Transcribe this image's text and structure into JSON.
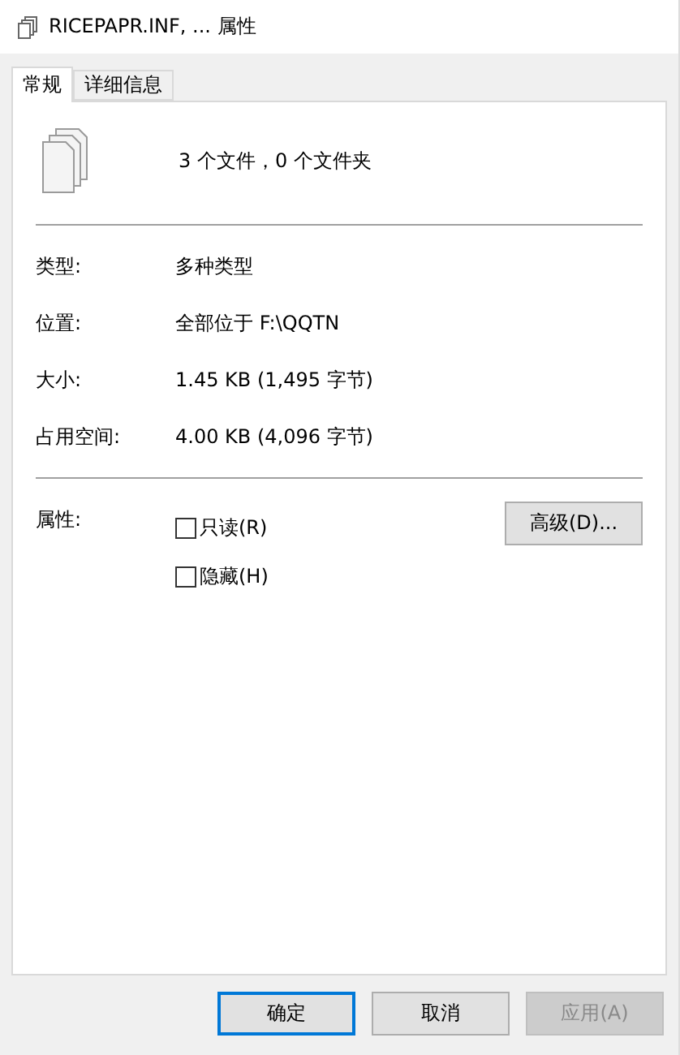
{
  "window": {
    "title": "RICEPAPR.INF, ... 属性"
  },
  "tabs": [
    {
      "label": "常规",
      "selected": true
    },
    {
      "label": "详细信息",
      "selected": false
    }
  ],
  "summary": "3 个文件，0 个文件夹",
  "details": [
    {
      "label": "类型:",
      "value": "多种类型"
    },
    {
      "label": "位置:",
      "value": "全部位于 F:\\QQTN"
    },
    {
      "label": "大小:",
      "value": "1.45 KB (1,495 字节)"
    },
    {
      "label": "占用空间:",
      "value": "4.00 KB (4,096 字节)"
    }
  ],
  "attributes": {
    "label": "属性:",
    "options": [
      {
        "label": "只读(R)",
        "checked": false
      },
      {
        "label": "隐藏(H)",
        "checked": false
      }
    ],
    "advanced_button": "高级(D)..."
  },
  "buttons": [
    {
      "label": "确定",
      "default": true,
      "disabled": false
    },
    {
      "label": "取消",
      "default": false,
      "disabled": false
    },
    {
      "label": "应用(A)",
      "default": false,
      "disabled": true
    }
  ]
}
